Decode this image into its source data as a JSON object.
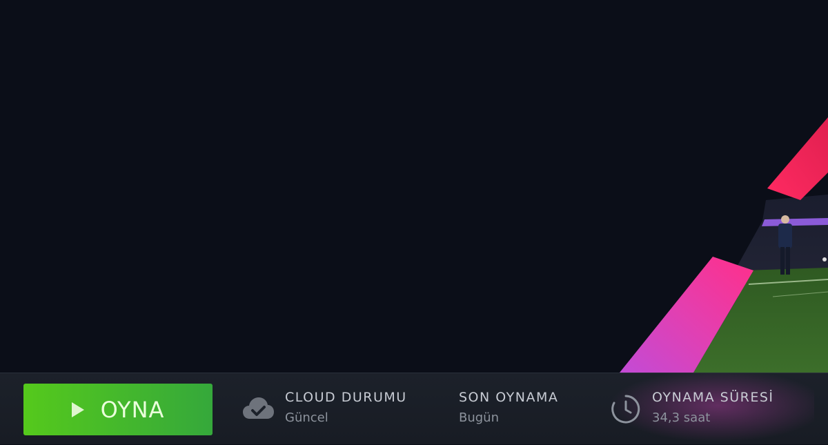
{
  "play_button": {
    "label": "OYNA"
  },
  "stats": {
    "cloud": {
      "title": "CLOUD DURUMU",
      "value": "Güncel",
      "icon": "cloud-check-icon"
    },
    "last_played": {
      "title": "SON OYNAMA",
      "value": "Bugün"
    },
    "playtime": {
      "title": "OYNAMA SÜRESİ",
      "value": "34,3 saat",
      "icon": "clock-icon"
    }
  },
  "colors": {
    "play_green": "#4cbf26",
    "accent_magenta": "#e33fb0",
    "accent_red": "#f2285a",
    "hero_bg": "#0b0e18"
  }
}
